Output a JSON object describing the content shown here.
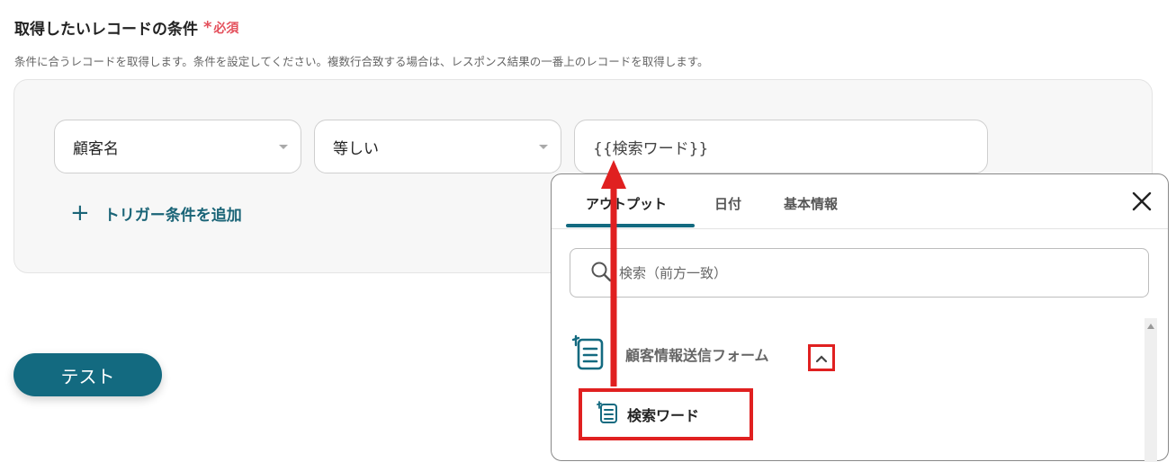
{
  "section": {
    "title": "取得したいレコードの条件",
    "required_mark": "*",
    "required_label": "必須",
    "description": "条件に合うレコードを取得します。条件を設定してください。複数行合致する場合は、レスポンス結果の一番上のレコードを取得します。"
  },
  "condition": {
    "field_value": "顧客名",
    "operator_value": "等しい",
    "input_value": "{{検索ワード}}"
  },
  "add_condition_label": "トリガー条件を追加",
  "test_button_label": "テスト",
  "popup": {
    "tabs": [
      "アウトプット",
      "日付",
      "基本情報"
    ],
    "active_tab": "アウトプット",
    "search_placeholder": "検索（前方一致）",
    "group_label": "顧客情報送信フォーム",
    "item_label": "検索ワード"
  },
  "colors": {
    "accent": "#136a80",
    "required": "#e4505c",
    "highlight": "#e02020"
  },
  "icons": [
    "plus-icon",
    "chevron-down-icon",
    "close-icon",
    "search-icon",
    "form-icon",
    "chevron-up-icon",
    "arrow-annotation"
  ]
}
